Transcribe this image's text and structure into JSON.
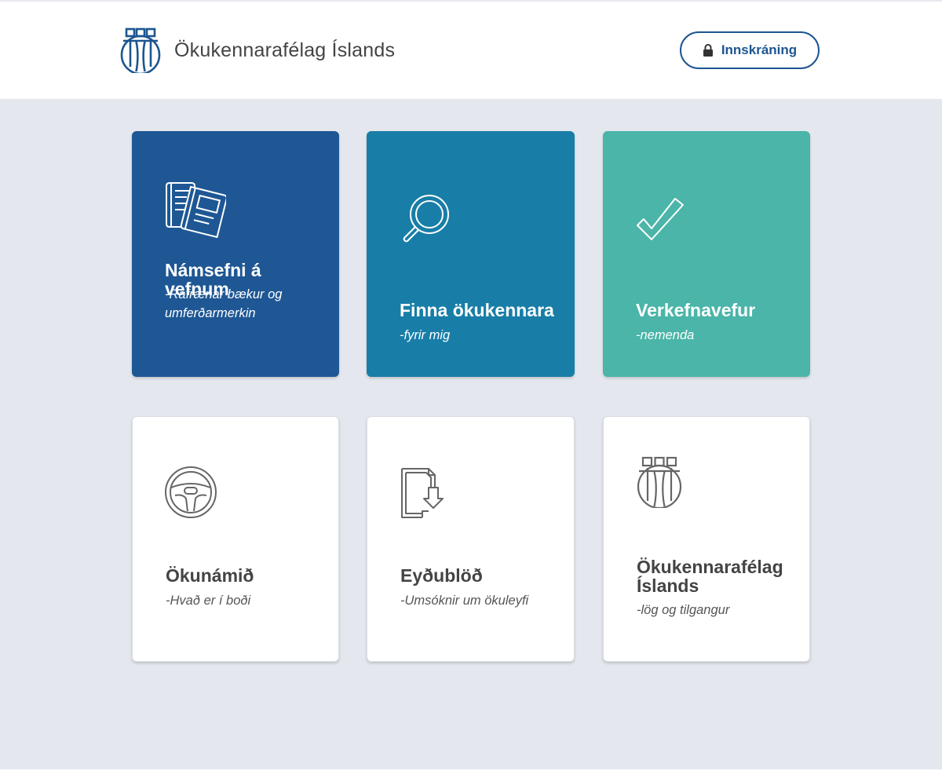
{
  "header": {
    "brand_name": "Ökukennarafélag Íslands",
    "login_label": "Innskráning"
  },
  "colors": {
    "brand_blue": "#1d5591",
    "card_study": "#1e5794",
    "card_find": "#187ea7",
    "card_tasks": "#4ab5a8",
    "page_background": "#e4e8ee"
  },
  "cards": [
    {
      "title": "Námsefni á vefnum",
      "subtitle": "-Rafrænar bækur og umferðarmerkin",
      "icon": "books-icon"
    },
    {
      "title": "Finna ökukennara",
      "subtitle": "-fyrir mig",
      "icon": "magnifier-icon"
    },
    {
      "title": "Verkefnavefur",
      "subtitle": "-nemenda",
      "icon": "checkmark-icon"
    },
    {
      "title": "Ökunámið",
      "subtitle": "-Hvað er í boði",
      "icon": "steering-wheel-icon"
    },
    {
      "title": "Eyðublöð",
      "subtitle": "-Umsóknir um ökuleyfi",
      "icon": "document-download-icon"
    },
    {
      "title": "Ökukennarafélag Íslands",
      "subtitle": "-lög og tilgangur",
      "icon": "association-logo-icon"
    }
  ]
}
